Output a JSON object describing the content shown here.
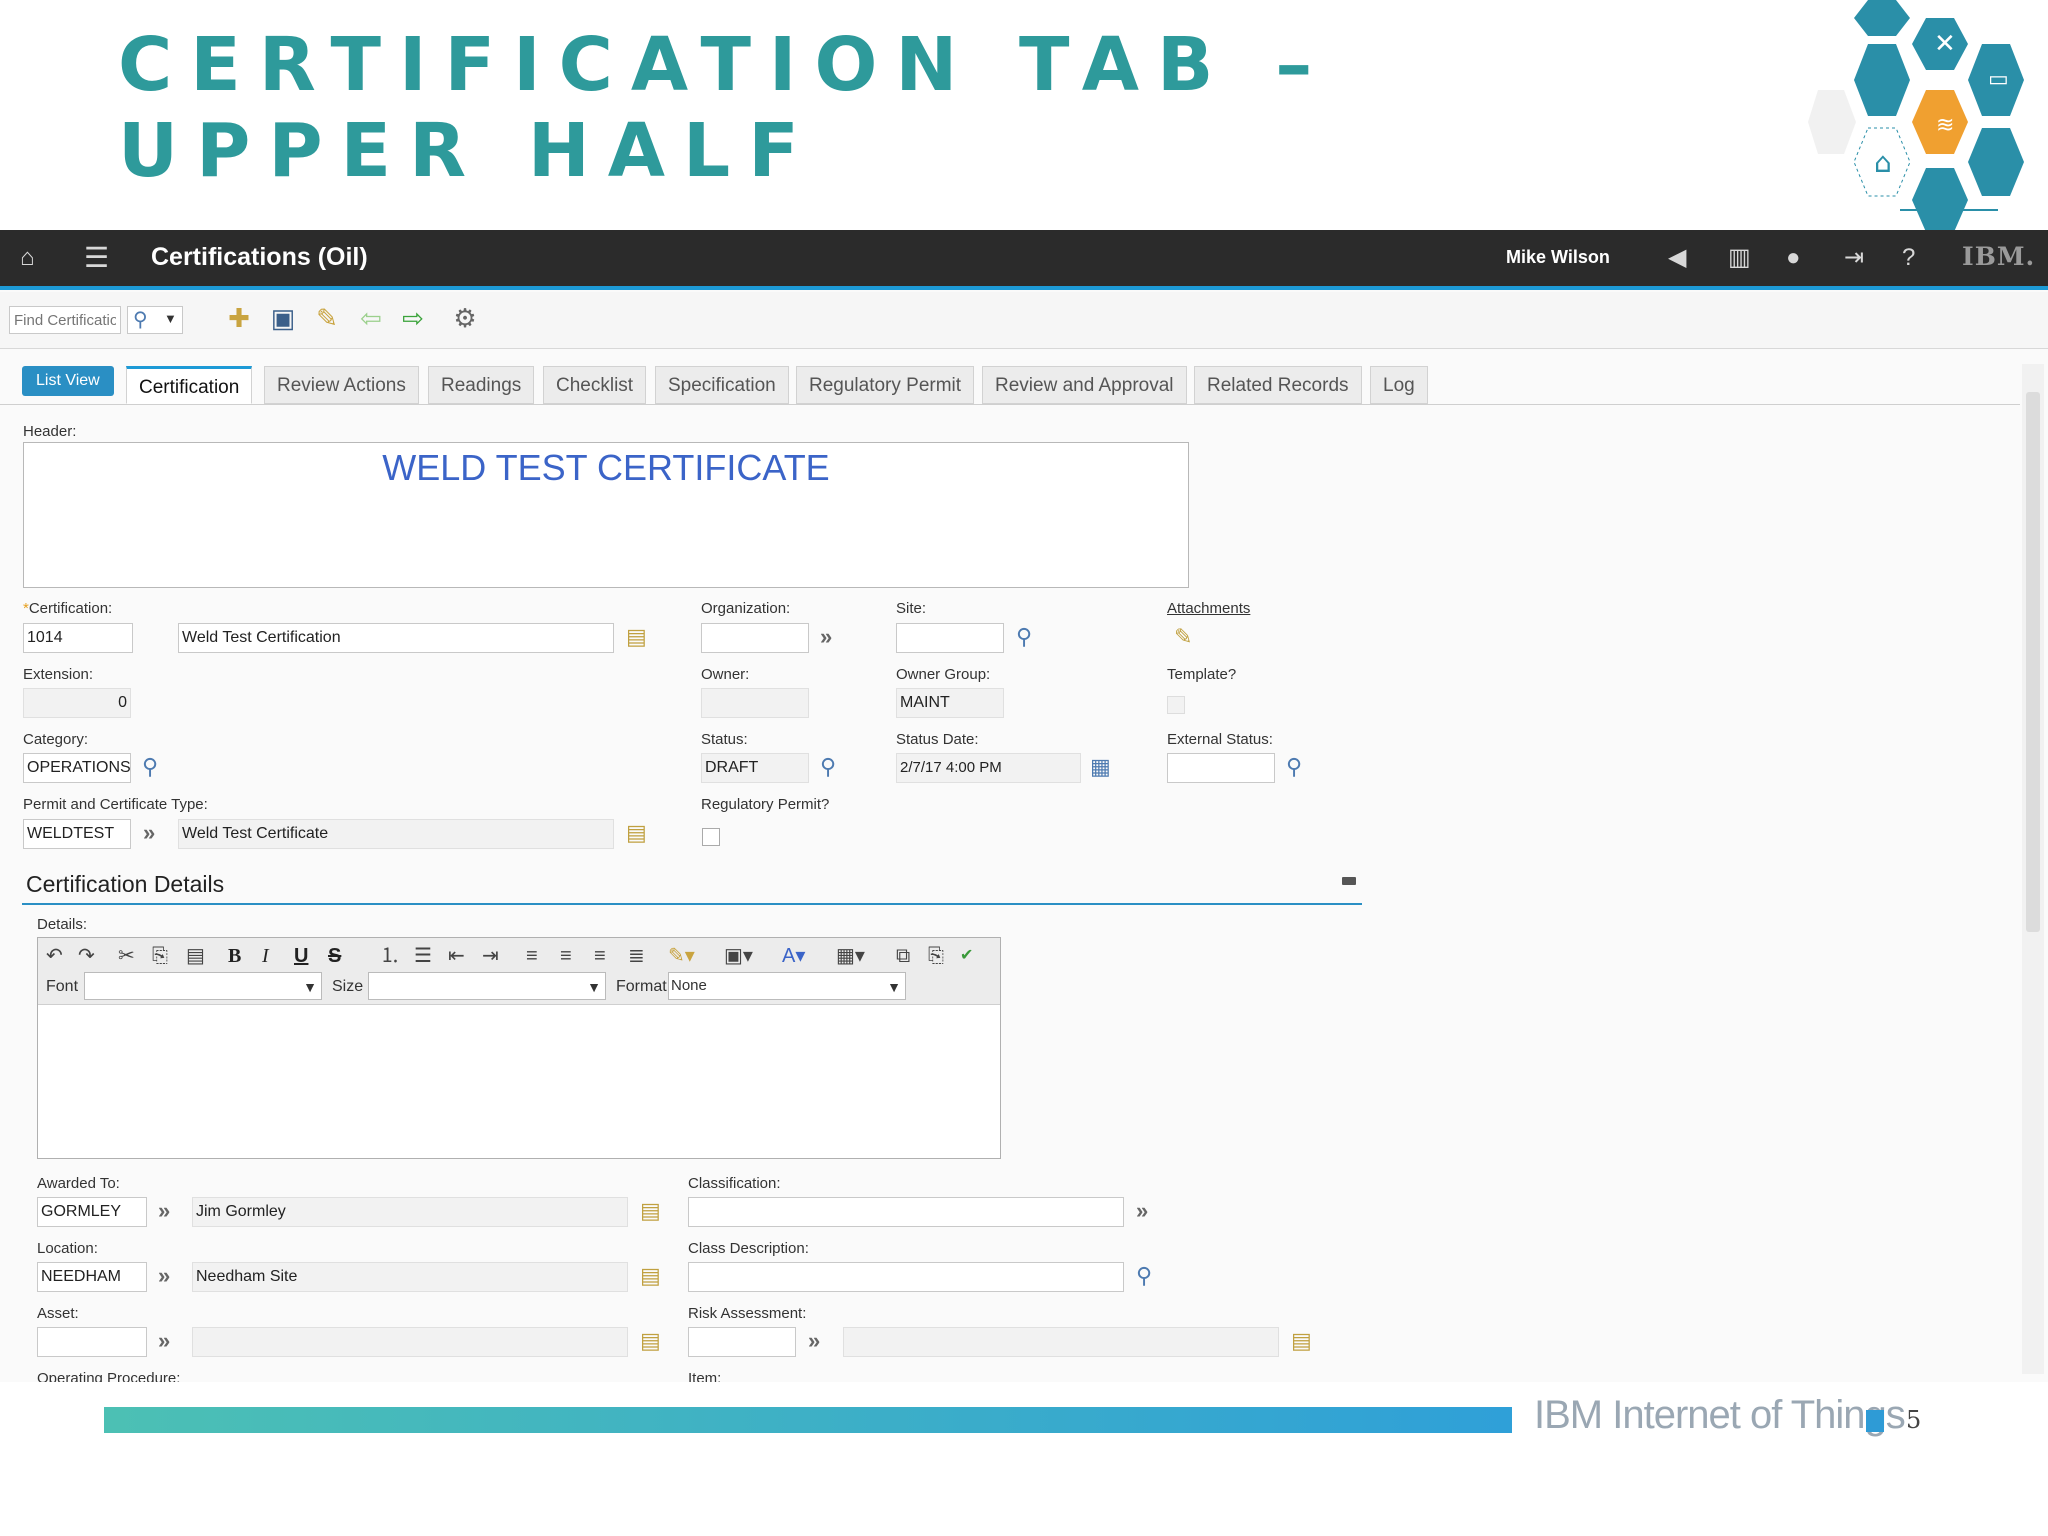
{
  "slide": {
    "title_line1": "Certification Tab –",
    "title_line2": "Upper Half",
    "footer_brand": "IBM Internet of Things",
    "page_number": "5",
    "colors": {
      "title": "#2e9a9b",
      "accent": "#1d9ad6",
      "hex_orange": "#f0a030"
    }
  },
  "app": {
    "title": "Certifications (Oil)",
    "user": "Mike Wilson",
    "brand": "IBM."
  },
  "toolbar": {
    "find_placeholder": "Find Certificatio"
  },
  "tabs": {
    "list_view": "List View",
    "items": [
      "Certification",
      "Review Actions",
      "Readings",
      "Checklist",
      "Specification",
      "Regulatory Permit",
      "Review and Approval",
      "Related Records",
      "Log"
    ]
  },
  "header": {
    "label": "Header:",
    "text": "WELD TEST CERTIFICATE"
  },
  "form": {
    "certification_label": "Certification:",
    "certification_value": "1014",
    "certification_desc": "Weld Test Certification",
    "organization_label": "Organization:",
    "organization_value": "",
    "site_label": "Site:",
    "site_value": "",
    "attachments_label": "Attachments",
    "extension_label": "Extension:",
    "extension_value": "0",
    "owner_label": "Owner:",
    "owner_value": "",
    "owner_group_label": "Owner Group:",
    "owner_group_value": "MAINT",
    "template_label": "Template?",
    "category_label": "Category:",
    "category_value": "OPERATIONS",
    "status_label": "Status:",
    "status_value": "DRAFT",
    "status_date_label": "Status Date:",
    "status_date_value": "2/7/17 4:00 PM",
    "external_status_label": "External Status:",
    "external_status_value": "",
    "permit_type_label": "Permit and Certificate Type:",
    "permit_type_value": "WELDTEST",
    "permit_type_desc": "Weld Test Certificate",
    "regulatory_permit_label": "Regulatory Permit?"
  },
  "details_section": {
    "title": "Certification Details",
    "details_label": "Details:",
    "font_label": "Font",
    "size_label": "Size",
    "format_label": "Format",
    "format_value": "None",
    "awarded_to_label": "Awarded To:",
    "awarded_to_value": "GORMLEY",
    "awarded_to_desc": "Jim Gormley",
    "classification_label": "Classification:",
    "classification_value": "",
    "location_label": "Location:",
    "location_value": "NEEDHAM",
    "location_desc": "Needham Site",
    "class_description_label": "Class Description:",
    "class_description_value": "",
    "asset_label": "Asset:",
    "asset_value": "",
    "risk_assessment_label": "Risk Assessment:",
    "risk_assessment_value": "",
    "operating_procedure_label": "Operating Procedure:",
    "item_label": "Item:"
  }
}
